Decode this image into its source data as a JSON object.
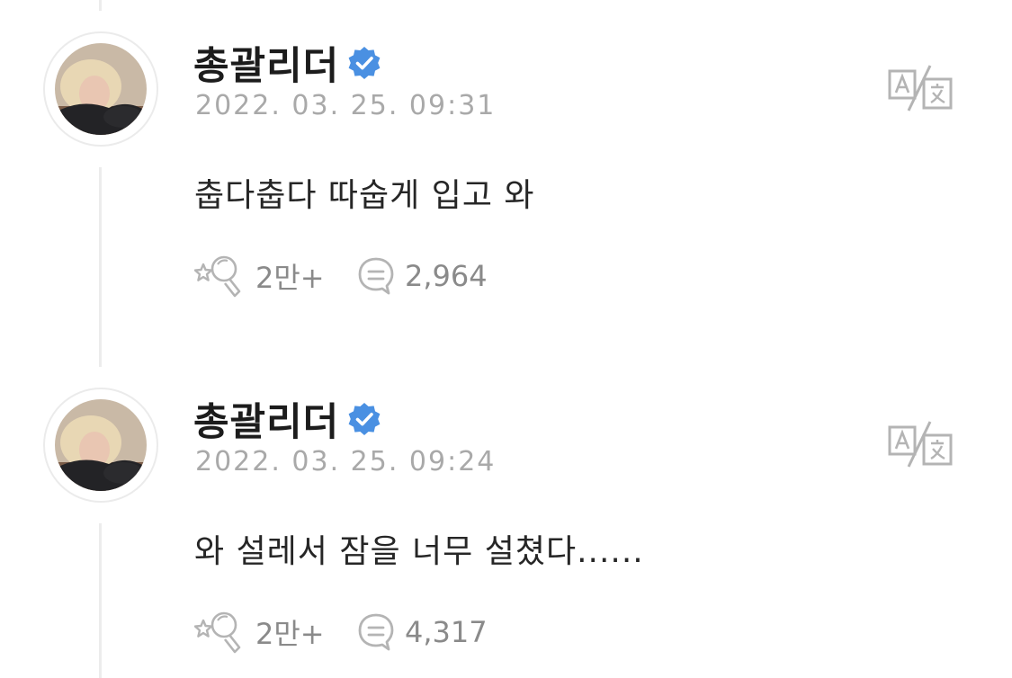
{
  "posts": [
    {
      "author": "총괄리더",
      "timestamp": "2022. 03. 25. 09:31",
      "body": "춥다춥다 따숩게 입고 와",
      "likes": "2만+",
      "comments": "2,964"
    },
    {
      "author": "총괄리더",
      "timestamp": "2022. 03. 25. 09:24",
      "body": "와 설레서 잠을 너무 설쳤다......",
      "likes": "2만+",
      "comments": "4,317"
    }
  ],
  "colors": {
    "verified": "#4a90e2",
    "timestamp": "#a9a9a9",
    "icon": "#b4b4b4",
    "thread_line": "#ececec"
  },
  "icons": {
    "verified": "verified-badge-icon",
    "translate": "translate-icon",
    "like": "like-icon",
    "comment": "comment-icon"
  }
}
